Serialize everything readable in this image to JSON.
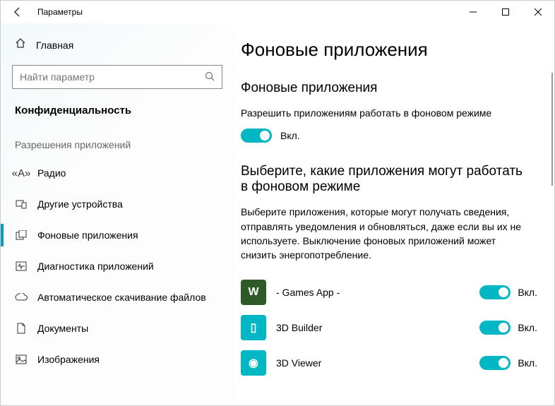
{
  "window": {
    "title": "Параметры"
  },
  "sidebar": {
    "home": "Главная",
    "search_placeholder": "Найти параметр",
    "category": "Конфиденциальность",
    "section": "Разрешения приложений",
    "items": [
      {
        "label": "Радио"
      },
      {
        "label": "Другие устройства"
      },
      {
        "label": "Фоновые приложения"
      },
      {
        "label": "Диагностика приложений"
      },
      {
        "label": "Автоматическое скачивание файлов"
      },
      {
        "label": "Документы"
      },
      {
        "label": "Изображения"
      }
    ]
  },
  "content": {
    "title": "Фоновые приложения",
    "section1_title": "Фоновые приложения",
    "section1_desc": "Разрешить приложениям работать в фоновом режиме",
    "on_label": "Вкл.",
    "section2_title": "Выберите, какие приложения могут работать в фоновом режиме",
    "section2_desc": "Выберите приложения, которые могут получать сведения, отправлять уведомления и обновляться, даже если вы их не используете. Выключение фоновых приложений может снизить энергопотребление.",
    "apps": [
      {
        "name": "- Games App -",
        "state": "Вкл.",
        "iconclass": "games",
        "glyph": "W"
      },
      {
        "name": "3D Builder",
        "state": "Вкл.",
        "iconclass": "builder",
        "glyph": "▯"
      },
      {
        "name": "3D Viewer",
        "state": "Вкл.",
        "iconclass": "viewer",
        "glyph": "◉"
      }
    ]
  }
}
